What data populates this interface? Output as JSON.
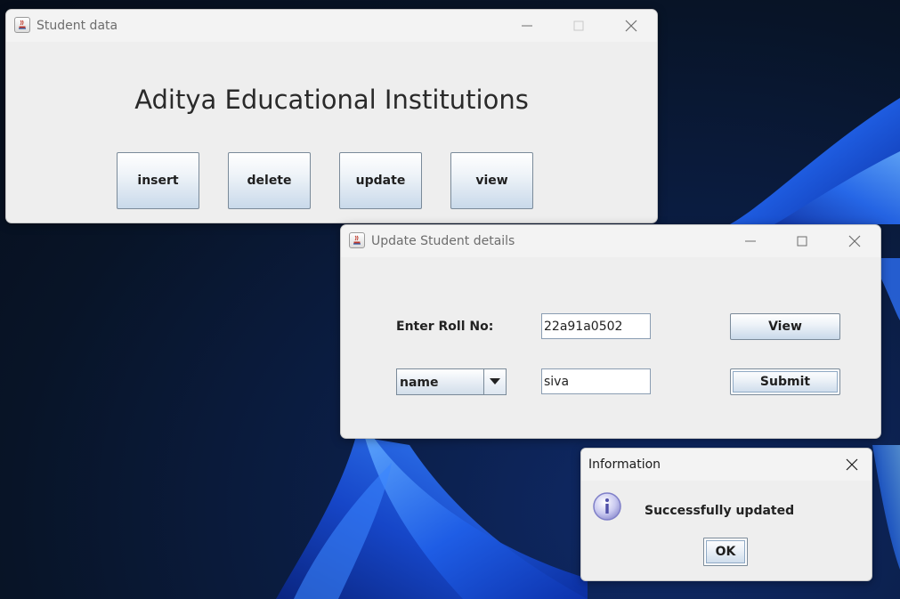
{
  "main_window": {
    "title": "Student data",
    "heading": "Aditya Educational Institutions",
    "buttons": {
      "insert": "insert",
      "delete": "delete",
      "update": "update",
      "view": "view"
    }
  },
  "update_window": {
    "title": "Update Student details",
    "roll_label": "Enter Roll No:",
    "roll_value": "22a91a0502",
    "field_select": {
      "selected": "name"
    },
    "new_value": "siva",
    "view_label": "View",
    "submit_label": "Submit"
  },
  "info_dialog": {
    "title": "Information",
    "message": "Successfully updated",
    "ok_label": "OK"
  },
  "icons": {
    "app": "java-icon",
    "info": "info-icon",
    "minimize": "minimize-icon",
    "maximize": "maximize-icon",
    "close": "close-icon",
    "dropdown": "chevron-down-icon"
  },
  "colors": {
    "desktop_bg": "#0a1628",
    "wallpaper_accent": "#1e63e0",
    "window_bg": "#eeeeee",
    "button_gradient_bottom": "#c9d9ea",
    "info_icon": "#7f7fc8"
  }
}
